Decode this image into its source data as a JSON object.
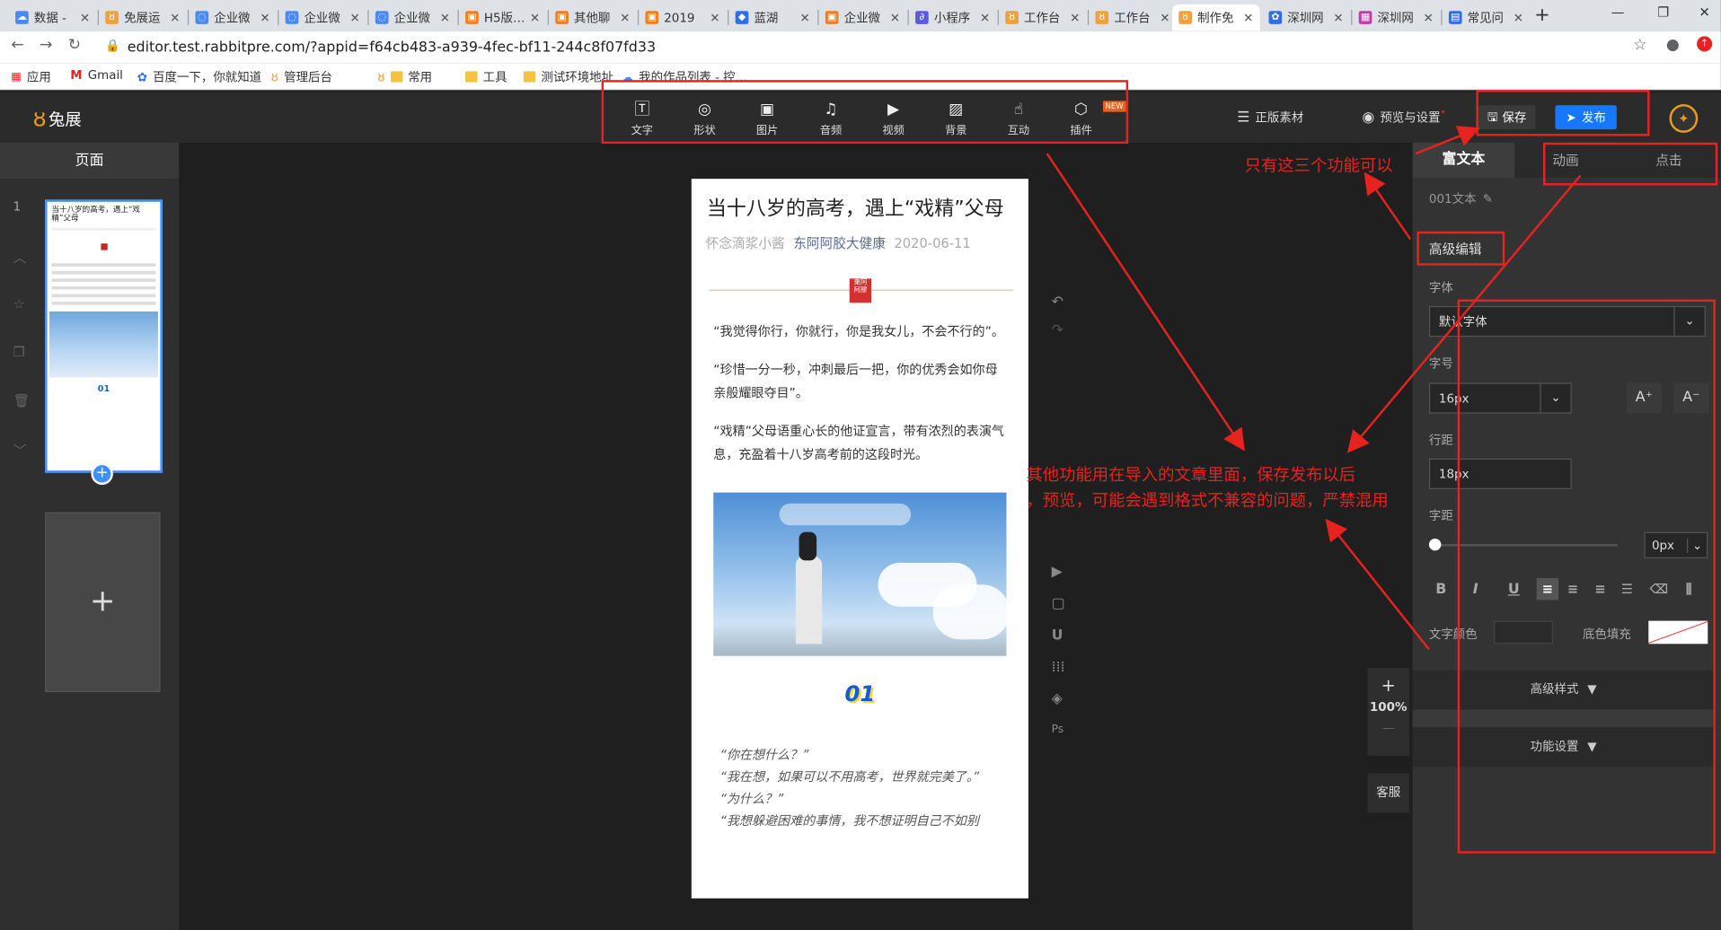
{
  "browser": {
    "tabs": [
      "数据 -",
      "免展运",
      "企业微",
      "企业微",
      "企业微",
      "H5版…",
      "其他聊",
      "2019",
      "蓝湖",
      "企业微",
      "小程序",
      "工作台",
      "工作台",
      "制作免",
      "深圳网",
      "深圳网",
      "常见问"
    ],
    "url": "editor.test.rabbitpre.com/?appid=f64cb483-a939-4fec-bf11-244c8f07fd33",
    "bookmarks": [
      "应用",
      "Gmail",
      "百度一下，你就知道",
      "管理后台",
      "常用",
      "工具",
      "测试环境地址",
      "我的作品列表 - 控..."
    ]
  },
  "app": {
    "logo": "兔展",
    "tools": [
      {
        "label": "文字",
        "icon": "text-icon"
      },
      {
        "label": "形状",
        "icon": "shape-icon"
      },
      {
        "label": "图片",
        "icon": "image-icon"
      },
      {
        "label": "音频",
        "icon": "music-icon"
      },
      {
        "label": "视频",
        "icon": "video-icon"
      },
      {
        "label": "背景",
        "icon": "background-icon"
      },
      {
        "label": "互动",
        "icon": "hand-icon"
      },
      {
        "label": "插件",
        "icon": "plugin-icon"
      }
    ],
    "new_badge": "NEW",
    "header_right": {
      "material": "正版素材",
      "preview": "预览与设置",
      "save": "保存",
      "publish": "发布"
    }
  },
  "left": {
    "title": "页面",
    "page_number": "1",
    "add": "+"
  },
  "doc": {
    "title": "当十八岁的高考，遇上“戏精”父母",
    "author": "怀念滴浆小酱",
    "source": "东阿阿胶大健康",
    "date": "2020-06-11",
    "paragraphs": [
      "“我觉得你行，你就行，你是我女儿，不会不行的”。",
      "“珍惜一分一秒，冲刺最后一把，你的优秀会如你母亲般耀眼夺目”。",
      "“戏精”父母语重心长的他证宣言，带有浓烈的表演气息，充盈着十八岁高考前的这段时光。"
    ],
    "number": "01",
    "quotes": [
      "“你在想什么？”",
      "“我在想，如果可以不用高考，世界就完美了。”",
      "“为什么？”",
      "“我想躲避困难的事情，我不想证明自己不如别"
    ]
  },
  "canvas": {
    "zoom": "100%",
    "zoom_plus": "+",
    "zoom_minus": "—",
    "kefu": "客服"
  },
  "right": {
    "tabs": [
      "富文本",
      "动画",
      "点击"
    ],
    "element_name": "001文本",
    "advanced_edit": "高级编辑",
    "font_label": "字体",
    "font_value": "默认字体",
    "size_label": "字号",
    "size_value": "16px",
    "line_label": "行距",
    "line_value": "18px",
    "spacing_label": "字距",
    "spacing_value": "0px",
    "color_label": "文字颜色",
    "bg_label": "底色填充",
    "advanced_style": "高级样式",
    "func_settings": "功能设置"
  },
  "annotations": {
    "only_three": "只有这三个功能可以",
    "warning_line1": "其他功能用在导入的文章里面，保存发布以后",
    "warning_line2": "，预览，可能会遇到格式不兼容的问题，严禁混用"
  },
  "colors": {
    "accent": "#1677ff",
    "annotation_red": "#e8221f",
    "app_dark": "#1f1f1f"
  }
}
